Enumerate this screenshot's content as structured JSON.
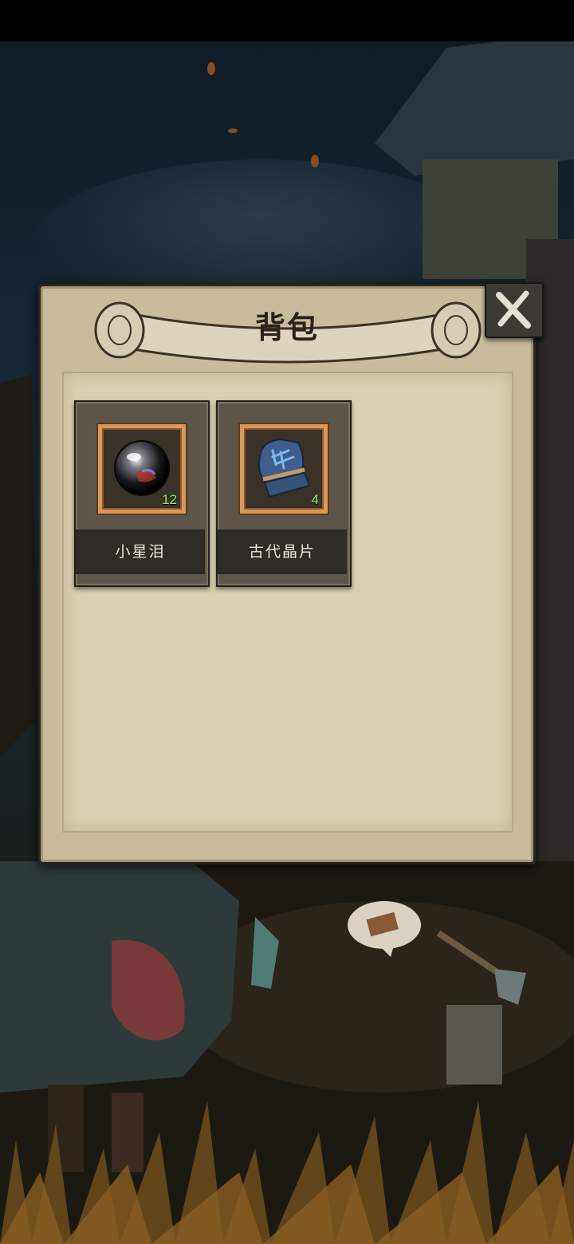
{
  "panel": {
    "title": "背包",
    "close_icon": "close-x-icon"
  },
  "inventory": {
    "items": [
      {
        "label": "小星泪",
        "count": "12",
        "icon": "star-tear-orb-icon"
      },
      {
        "label": "古代晶片",
        "count": "4",
        "icon": "ancient-crystal-shard-icon"
      }
    ]
  },
  "colors": {
    "panel_bg": "#c8bc9d",
    "panel_inner": "#d9d0b1",
    "frame": "#d89a5a",
    "count_text": "#8df05a"
  }
}
